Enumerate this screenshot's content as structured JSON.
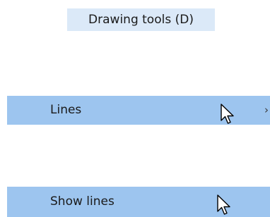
{
  "tooltip": {
    "text": "Drawing tools (D)"
  },
  "menu": {
    "items": [
      {
        "label": "Lines",
        "has_submenu": true,
        "submenu_glyph": "›",
        "state": "highlighted"
      },
      {
        "label": "Show lines",
        "has_submenu": false,
        "state": "highlighted"
      }
    ]
  },
  "colors": {
    "tooltip_bg": "#dbe9f8",
    "highlight_bg": "#9dc5ef",
    "text": "#1a1a1a"
  },
  "icons": {
    "cursor": "mouse-pointer-icon",
    "submenu": "chevron-right-icon"
  }
}
